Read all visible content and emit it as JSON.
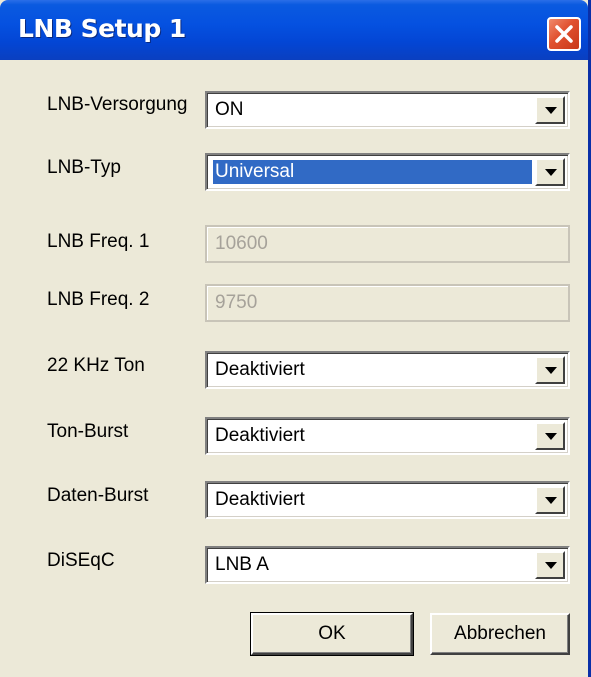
{
  "window": {
    "title": "LNB Setup 1"
  },
  "fields": {
    "lnb_supply": {
      "label": "LNB-Versorgung",
      "value": "ON"
    },
    "lnb_type": {
      "label": "LNB-Typ",
      "value": "Universal"
    },
    "freq1": {
      "label": "LNB Freq. 1",
      "value": "10600"
    },
    "freq2": {
      "label": "LNB Freq. 2",
      "value": "9750"
    },
    "tone22k": {
      "label": "22 KHz Ton",
      "value": "Deaktiviert"
    },
    "tone_burst": {
      "label": "Ton-Burst",
      "value": "Deaktiviert"
    },
    "data_burst": {
      "label": "Daten-Burst",
      "value": "Deaktiviert"
    },
    "diseqc": {
      "label": "DiSEqC",
      "value": "LNB A"
    }
  },
  "buttons": {
    "ok": "OK",
    "cancel": "Abbrechen"
  },
  "colors": {
    "titlebar": "#0551e0",
    "dialog_bg": "#ece9d8",
    "selection": "#316ac5",
    "close_button": "#e0502e"
  }
}
